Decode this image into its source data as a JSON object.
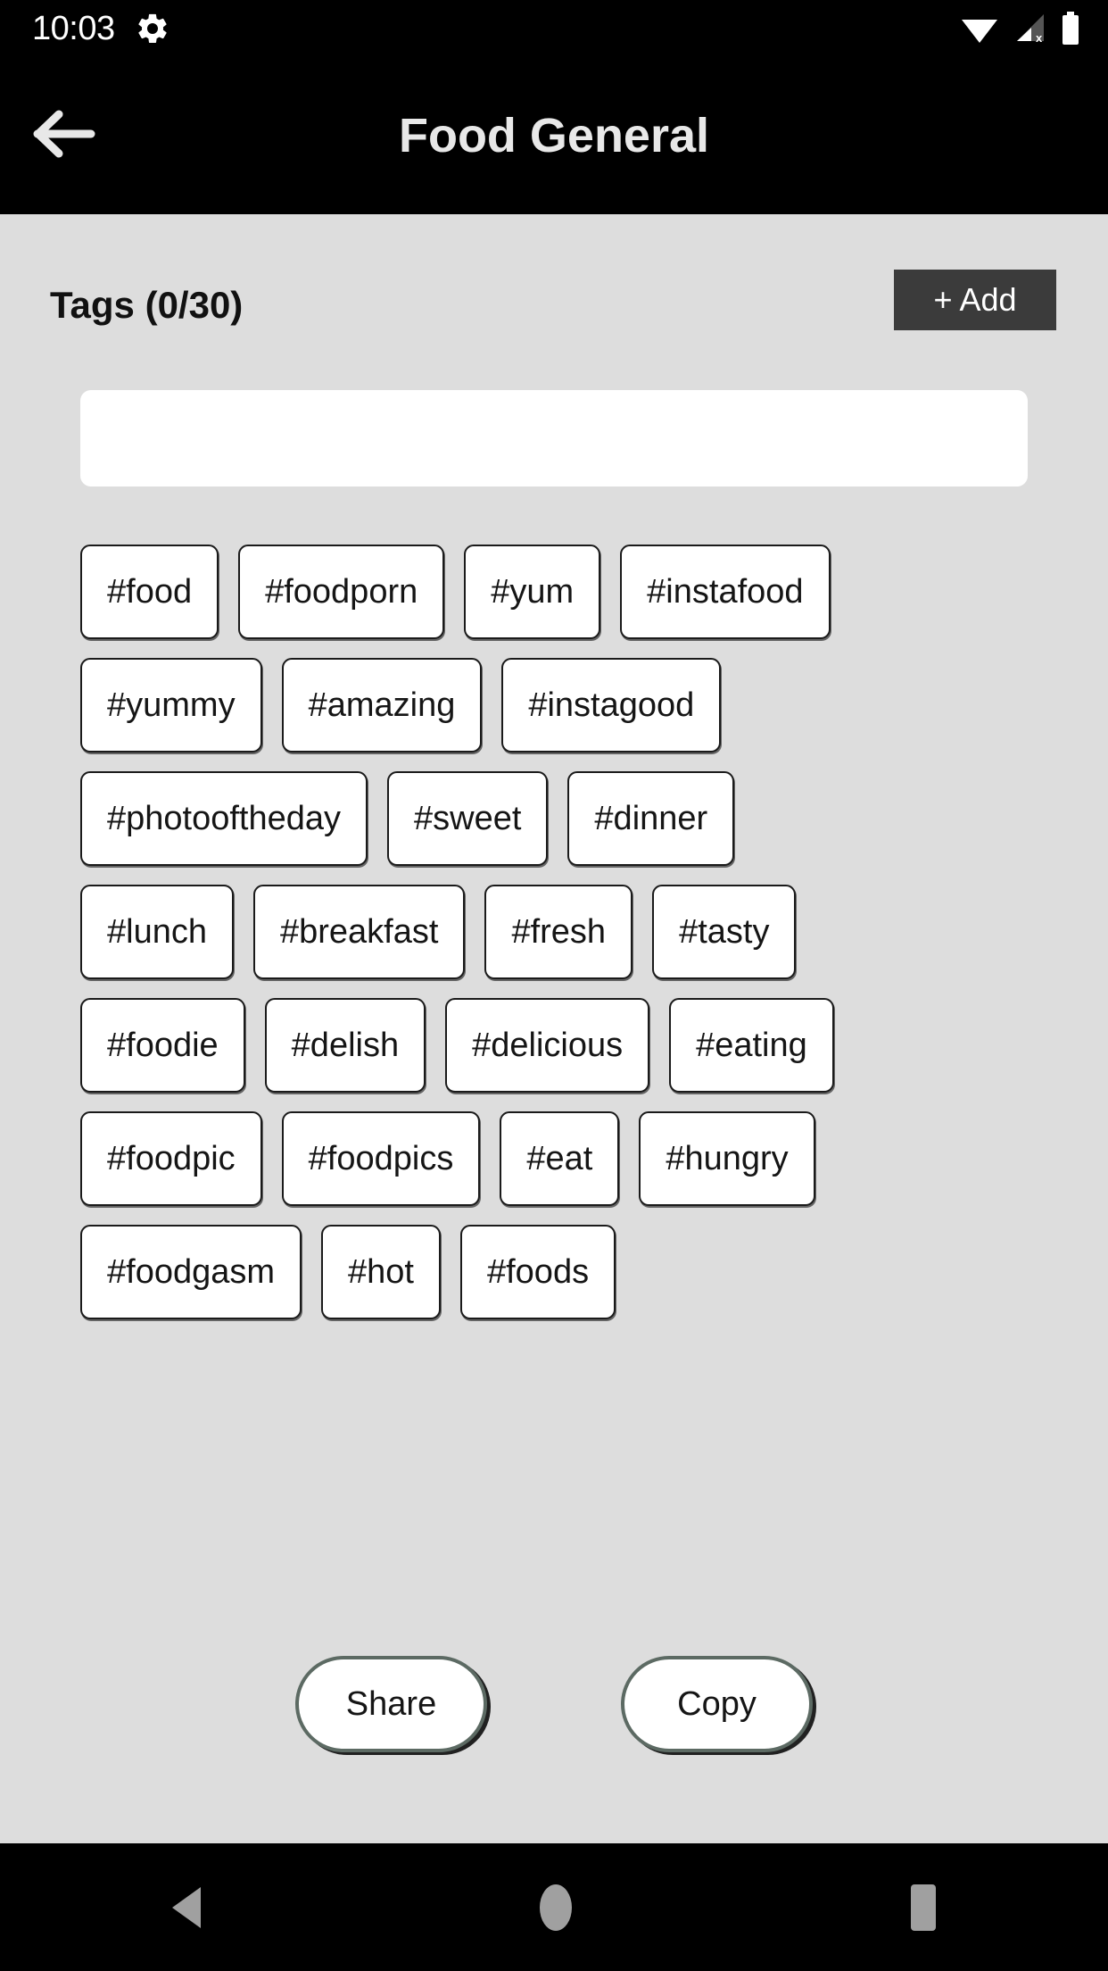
{
  "status_bar": {
    "time": "10:03",
    "icons": [
      "gear-icon",
      "wifi-icon",
      "cell-signal-no-sim-icon",
      "battery-full-icon"
    ]
  },
  "title_bar": {
    "back_icon": "arrow-left-icon",
    "title": "Food General"
  },
  "content": {
    "tags_header": "Tags (0/30)",
    "add_button": "+ Add",
    "input_value": "",
    "input_placeholder": "",
    "tag_rows": [
      [
        "#food",
        "#foodporn",
        "#yum",
        "#instafood"
      ],
      [
        "#yummy",
        "#amazing",
        "#instagood"
      ],
      [
        "#photooftheday",
        "#sweet",
        "#dinner"
      ],
      [
        "#lunch",
        "#breakfast",
        "#fresh",
        "#tasty"
      ],
      [
        "#foodie",
        "#delish",
        "#delicious",
        "#eating"
      ],
      [
        "#foodpic",
        "#foodpics",
        "#eat",
        "#hungry"
      ],
      [
        "#foodgasm",
        "#hot",
        "#foods"
      ]
    ],
    "share_button": "Share",
    "copy_button": "Copy"
  },
  "nav_bar": {
    "back": "nav-back-icon",
    "home": "nav-home-icon",
    "recents": "nav-recents-icon"
  },
  "colors": {
    "system_bar": "#000000",
    "page_background": "#dddddd",
    "add_button": "#3b3b3b",
    "chip_border": "#1a1a1a",
    "pill_border": "#5c6a63",
    "nav_icon": "#a0a0a0"
  }
}
